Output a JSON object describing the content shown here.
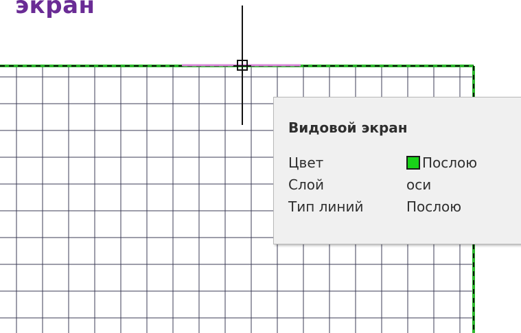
{
  "slide": {
    "title": "экран"
  },
  "tooltip": {
    "title": "Видовой экран",
    "rows": [
      {
        "label": "Цвет",
        "value": "Послою",
        "has_swatch": true
      },
      {
        "label": "Слой",
        "value": "оси"
      },
      {
        "label": "Тип линий",
        "value": "Послою"
      }
    ]
  },
  "colors": {
    "title": "#6a2c95",
    "viewport_border": "#2db82d",
    "selection_highlight": "#d88ad8",
    "grid_line": "#3b3b55",
    "color_swatch": "#19d219",
    "tooltip_bg": "#f0f0f0"
  },
  "icons": {
    "cursor": "crosshair-pickbox-icon",
    "swatch": "color-swatch-icon"
  }
}
